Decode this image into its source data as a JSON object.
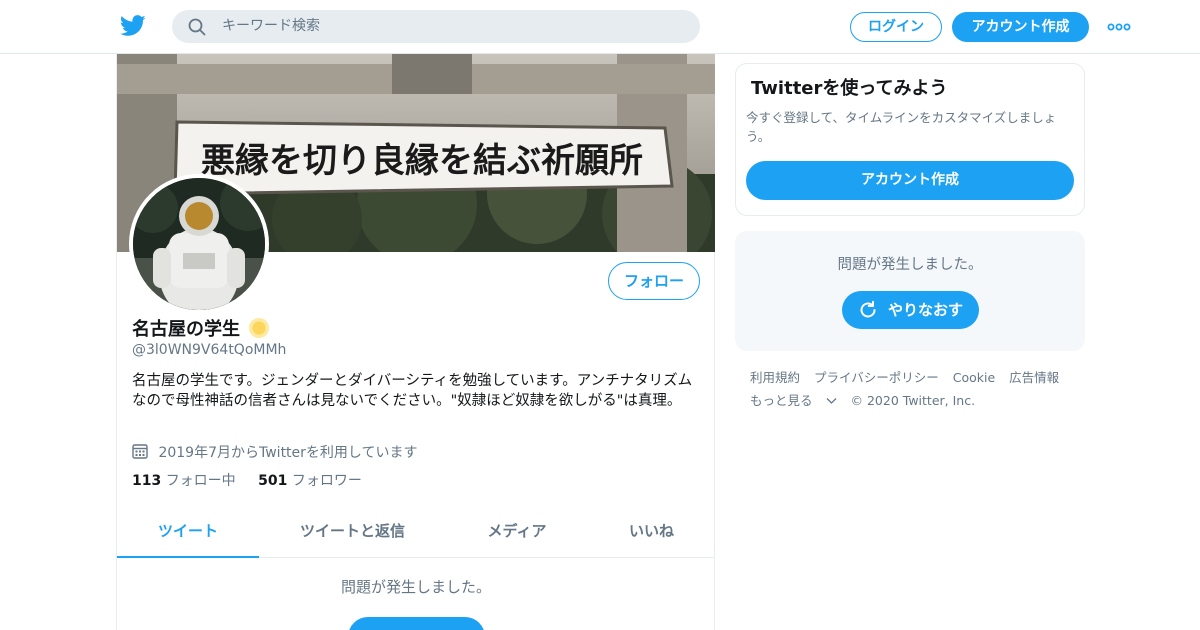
{
  "topbar": {
    "search_placeholder": "キーワード検索",
    "login_label": "ログイン",
    "signup_label": "アカウント作成"
  },
  "profile": {
    "banner_sign_text": "悪縁を切り良縁を結ぶ祈願所",
    "follow_label": "フォロー",
    "display_name": "名古屋の学生",
    "handle": "@3l0WN9V64tQoMMh",
    "bio": "名古屋の学生です。ジェンダーとダイバーシティを勉強しています。アンチナタリズムなので母性神話の信者さんは見ないでください。\"奴隷ほど奴隷を欲しがる\"は真理。",
    "joined": "2019年7月からTwitterを利用しています",
    "following_count": "113",
    "following_label": "フォロー中",
    "followers_count": "501",
    "followers_label": "フォロワー"
  },
  "tabs": [
    {
      "label": "ツイート",
      "active": true
    },
    {
      "label": "ツイートと返信",
      "active": false
    },
    {
      "label": "メディア",
      "active": false
    },
    {
      "label": "いいね",
      "active": false
    }
  ],
  "main_error": {
    "message": "問題が発生しました。"
  },
  "signup_card": {
    "title": "Twitterを使ってみよう",
    "description": "今すぐ登録して、タイムラインをカスタマイズしましょう。",
    "button_label": "アカウント作成"
  },
  "side_error": {
    "message": "問題が発生しました。",
    "retry_label": "やりなおす"
  },
  "footer": {
    "links": [
      "利用規約",
      "プライバシーポリシー",
      "Cookie",
      "広告情報"
    ],
    "more_label": "もっと見る",
    "copyright": "© 2020 Twitter, Inc."
  },
  "colors": {
    "accent": "#1da1f2",
    "muted_text": "#657786",
    "border": "#e6ecf0"
  },
  "icons": [
    "twitter-bird-icon",
    "search-icon",
    "more-dots-icon",
    "sun-emoji-icon",
    "calendar-icon",
    "refresh-icon",
    "chevron-down-icon"
  ]
}
